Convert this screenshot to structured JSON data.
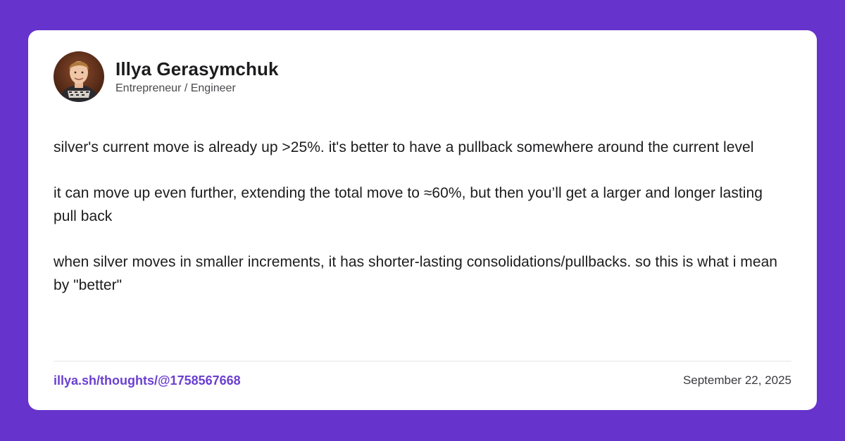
{
  "background_color": "#6633cc",
  "accent_color": "#6b3fd1",
  "author": {
    "name": "Illya Gerasymchuk",
    "role": "Entrepreneur / Engineer",
    "avatar_icon": "avatar-photo"
  },
  "post": {
    "paragraphs": [
      "silver's current move is already up >25%. it's better to have a pullback somewhere around the current level",
      "it can move up even further, extending the total move to ≈60%, but then you’ll get a larger and longer lasting pull back",
      "when silver moves in smaller increments, it has shorter-lasting consolidations/pullbacks. so this is what i mean by \"better\""
    ]
  },
  "footer": {
    "link_text": "illya.sh/thoughts/@1758567668",
    "date": "September 22, 2025"
  }
}
